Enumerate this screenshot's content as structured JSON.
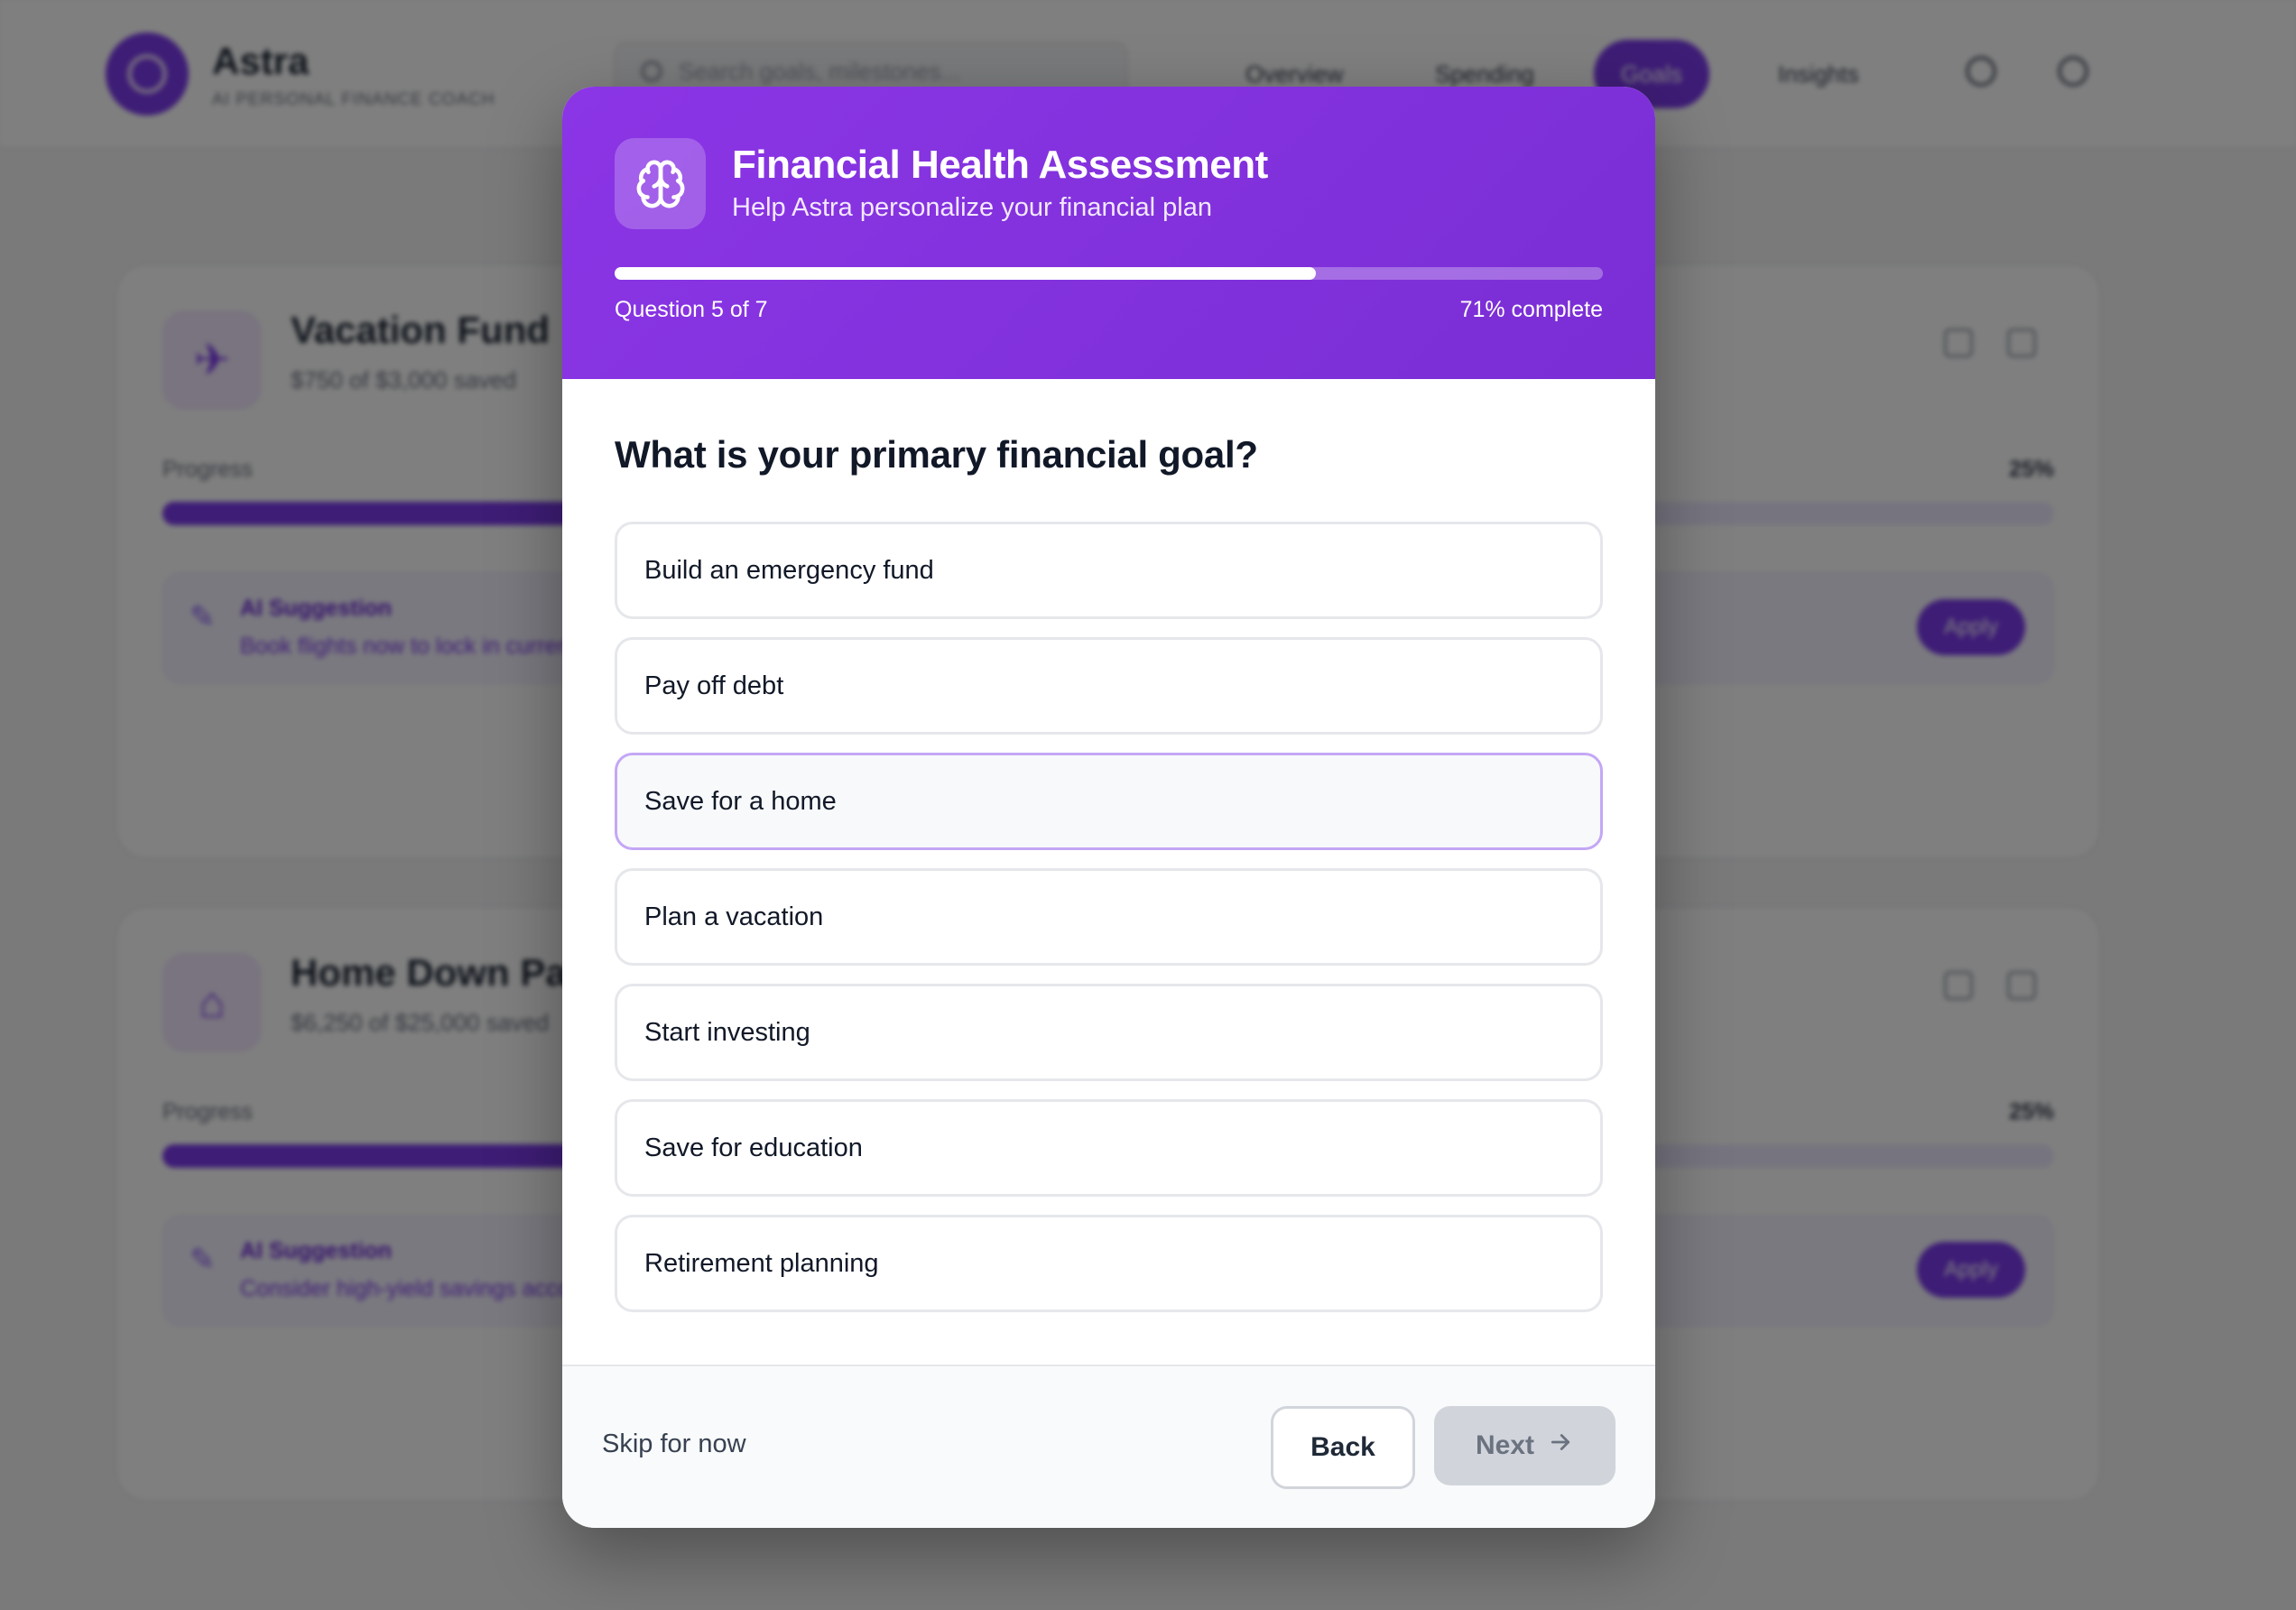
{
  "background": {
    "app_name": "Astra",
    "app_subtitle": "AI PERSONAL FINANCE COACH",
    "search_placeholder": "Search goals, milestones...",
    "nav_tabs": [
      "Overview",
      "Spending",
      "Goals",
      "Insights"
    ],
    "active_tab": "Goals",
    "goals": [
      {
        "title": "Vacation Fund",
        "subtitle": "$750 of $3,000 saved",
        "progress_label": "Progress",
        "progress_percent": "25%",
        "progress_value": 0.25,
        "suggestion_title": "AI Suggestion",
        "suggestion_text": "Book flights now to lock in current fares",
        "apply_label": "Apply"
      },
      {
        "title": "Home Down Payment",
        "subtitle": "$6,250 of $25,000 saved",
        "progress_label": "Progress",
        "progress_percent": "25%",
        "progress_value": 0.25,
        "suggestion_title": "AI Suggestion",
        "suggestion_text": "Consider high-yield savings account",
        "apply_label": "Apply"
      }
    ]
  },
  "modal": {
    "title": "Financial Health Assessment",
    "subtitle": "Help Astra personalize your financial plan",
    "question_counter": "Question 5 of 7",
    "percent_complete": "71% complete",
    "progress_value": 0.71,
    "question": "What is your primary financial goal?",
    "options": [
      "Build an emergency fund",
      "Pay off debt",
      "Save for a home",
      "Plan a vacation",
      "Start investing",
      "Save for education",
      "Retirement planning"
    ],
    "hovered_option": "Save for a home",
    "skip_label": "Skip for now",
    "back_label": "Back",
    "next_label": "Next",
    "icons": {
      "header": "brain-icon",
      "next": "arrow-right-icon"
    },
    "colors": {
      "header_gradient_start": "#8b35e6",
      "header_gradient_end": "#7a2ed4",
      "accent": "#7c3aed",
      "next_disabled_bg": "#d1d5db"
    }
  }
}
